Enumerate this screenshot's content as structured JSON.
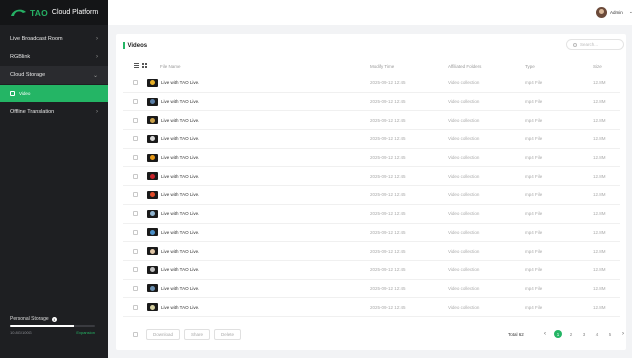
{
  "brand": {
    "logo_text": "TAO",
    "title": "Cloud Platform"
  },
  "sidebar": {
    "items": [
      {
        "label": "Live Broadcast Room",
        "chevron": "›"
      },
      {
        "label": "RGBlink",
        "chevron": "›"
      },
      {
        "label": "Cloud Storage",
        "chevron": "⌄"
      },
      {
        "label": "Video"
      },
      {
        "label": "Offline Translation",
        "chevron": "›"
      }
    ]
  },
  "storage": {
    "title": "Personal Storage",
    "used_fraction": 0.75,
    "used_label": "10.8G/100G",
    "expansion_label": "Expansion"
  },
  "header": {
    "user": "Admin",
    "caret": "⌄"
  },
  "main": {
    "title": "Videos",
    "search_placeholder": "Search...",
    "columns": {
      "name": "File Name",
      "time": "Modify Time",
      "folder": "Affiliated Folders",
      "type": "Type",
      "size": "Size"
    },
    "rows": [
      {
        "name": "Live with TAO Live.",
        "time": "2025-09-12 12:45",
        "folder": "Video collection",
        "type": "mp4 File",
        "size": "12.8M",
        "thumb_color": "#e8b128"
      },
      {
        "name": "Live with TAO Live.",
        "time": "2025-09-12 12:45",
        "folder": "Video collection",
        "type": "mp4 File",
        "size": "12.8M",
        "thumb_color": "#5a7fa8"
      },
      {
        "name": "Live with TAO Live.",
        "time": "2025-09-12 12:45",
        "folder": "Video collection",
        "type": "mp4 File",
        "size": "12.8M",
        "thumb_color": "#c9a04a"
      },
      {
        "name": "Live with TAO Live.",
        "time": "2025-09-12 12:45",
        "folder": "Video collection",
        "type": "mp4 File",
        "size": "12.8M",
        "thumb_color": "#d8d8d8"
      },
      {
        "name": "Live with TAO Live.",
        "time": "2025-09-12 12:45",
        "folder": "Video collection",
        "type": "mp4 File",
        "size": "12.8M",
        "thumb_color": "#e89a1a"
      },
      {
        "name": "Live with TAO Live.",
        "time": "2025-09-12 12:45",
        "folder": "Video collection",
        "type": "mp4 File",
        "size": "12.8M",
        "thumb_color": "#c8232a"
      },
      {
        "name": "Live with TAO Live.",
        "time": "2025-09-12 12:45",
        "folder": "Video collection",
        "type": "mp4 File",
        "size": "12.8M",
        "thumb_color": "#e14b2a"
      },
      {
        "name": "Live with TAO Live.",
        "time": "2025-09-12 12:45",
        "folder": "Video collection",
        "type": "mp4 File",
        "size": "12.8M",
        "thumb_color": "#8fb3cf"
      },
      {
        "name": "Live with TAO Live.",
        "time": "2025-09-12 12:45",
        "folder": "Video collection",
        "type": "mp4 File",
        "size": "12.8M",
        "thumb_color": "#4a8fc8"
      },
      {
        "name": "Live with TAO Live.",
        "time": "2025-09-12 12:45",
        "folder": "Video collection",
        "type": "mp4 File",
        "size": "12.8M",
        "thumb_color": "#e2c8a8"
      },
      {
        "name": "Live with TAO Live.",
        "time": "2025-09-12 12:45",
        "folder": "Video collection",
        "type": "mp4 File",
        "size": "12.8M",
        "thumb_color": "#bfbfbf"
      },
      {
        "name": "Live with TAO Live.",
        "time": "2025-09-12 12:45",
        "folder": "Video collection",
        "type": "mp4 File",
        "size": "12.8M",
        "thumb_color": "#6a8fb0"
      },
      {
        "name": "Live with TAO Live.",
        "time": "2025-09-12 12:45",
        "folder": "Video collection",
        "type": "mp4 File",
        "size": "12.8M",
        "thumb_color": "#d6d0a0"
      }
    ]
  },
  "footer": {
    "download_label": "Download",
    "share_label": "Share",
    "delete_label": "Delete",
    "total_label": "Total 62",
    "pages": [
      "1",
      "2",
      "3",
      "4",
      "5"
    ],
    "current_page": "1",
    "prev": "‹",
    "next": "›"
  },
  "colors": {
    "accent": "#24b565",
    "sidebar": "#1e1f22"
  }
}
